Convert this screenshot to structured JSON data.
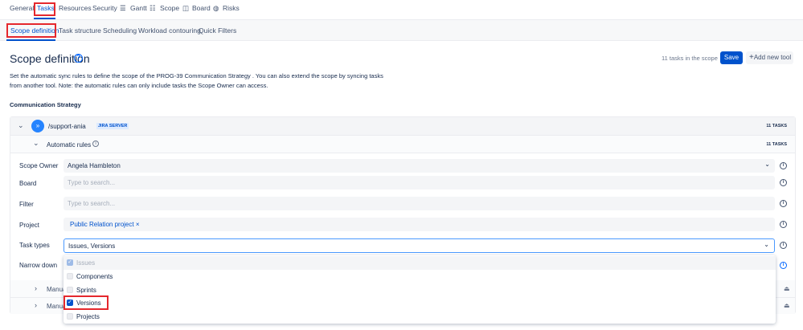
{
  "top_nav": {
    "items": [
      "General",
      "Tasks",
      "Resources",
      "Security",
      "Gantt",
      "Scope",
      "Board",
      "Risks"
    ],
    "active": "Tasks"
  },
  "sub_nav": {
    "items": [
      "Scope definition",
      "Task structure",
      "Scheduling",
      "Workload contouring",
      "Quick Filters"
    ],
    "active": "Scope definition"
  },
  "page": {
    "title": "Scope definition",
    "description": "Set the automatic sync rules to define the scope of the PROG-39 Communication Strategy . You can also extend the scope by syncing tasks from another tool. Note: the automatic rules can only include tasks the Scope Owner can access.",
    "tasks_in_scope": "11 tasks in the scope",
    "save_label": "Save",
    "add_tool_label": "Add new tool",
    "section_title": "Communication Strategy"
  },
  "source": {
    "name": "/support-ania",
    "badge": "JIRA SERVER",
    "count": "11 TASKS"
  },
  "automatic_rules": {
    "label": "Automatic rules",
    "count": "11 TASKS"
  },
  "form": {
    "scope_owner": {
      "label": "Scope Owner",
      "value": "Angela Hambleton"
    },
    "board": {
      "label": "Board",
      "placeholder": "Type to search..."
    },
    "filter": {
      "label": "Filter",
      "placeholder": "Type to search..."
    },
    "project": {
      "label": "Project",
      "tag": "Public Relation project"
    },
    "task_types": {
      "label": "Task types",
      "value": "Issues, Versions"
    },
    "narrow_down": {
      "label": "Narrow down"
    }
  },
  "manual_rows": [
    "Manual",
    "Manual"
  ],
  "dropdown": {
    "options": [
      {
        "label": "Issues",
        "checked": true,
        "disabled": true
      },
      {
        "label": "Components",
        "checked": false
      },
      {
        "label": "Sprints",
        "checked": false
      },
      {
        "label": "Versions",
        "checked": true
      },
      {
        "label": "Projects",
        "checked": false
      }
    ]
  },
  "colors": {
    "accent": "#0052cc",
    "highlight": "#e5282d"
  }
}
